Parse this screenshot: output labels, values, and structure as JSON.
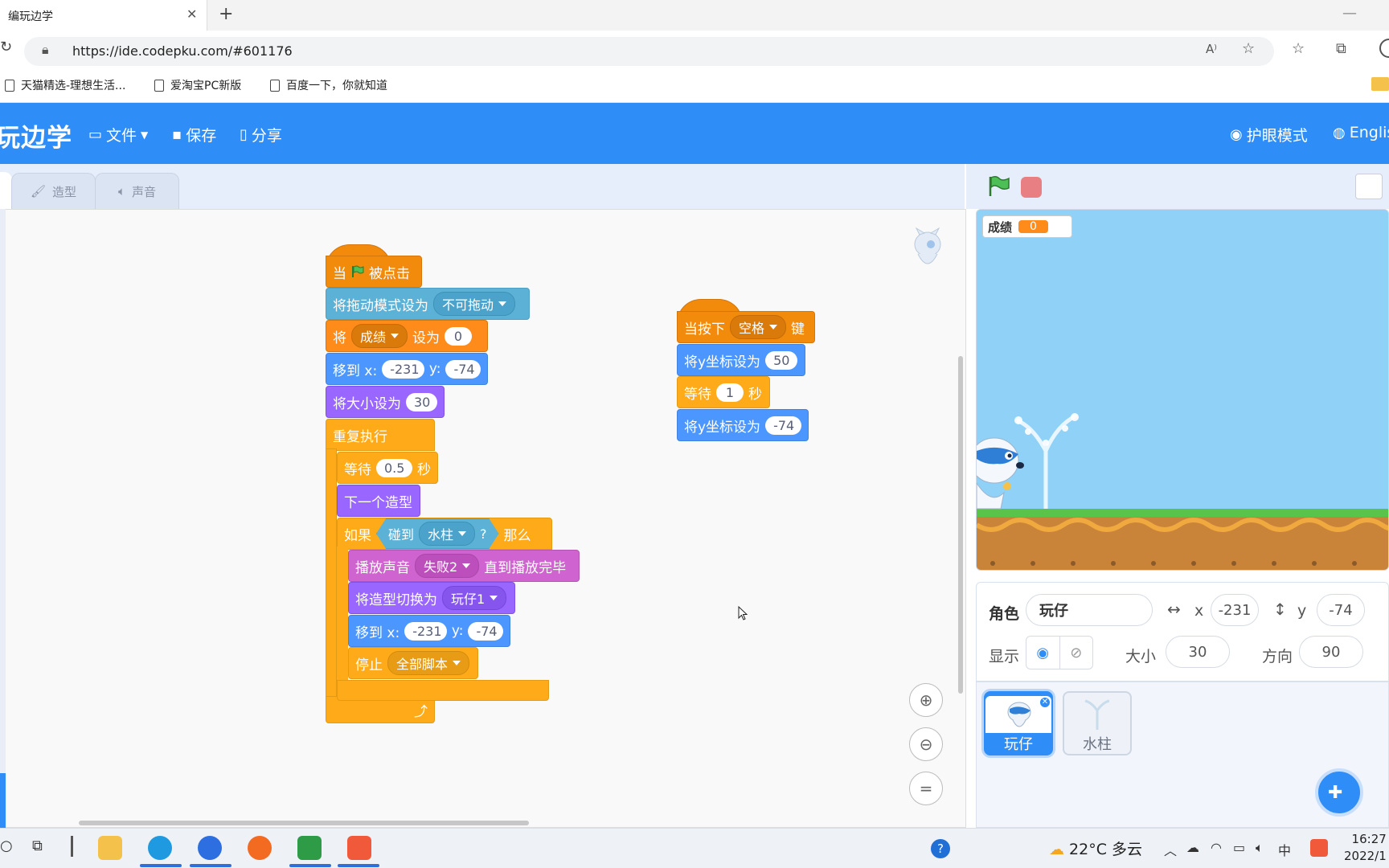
{
  "browser": {
    "tab_title": "编玩边学",
    "tab_close": "✕",
    "new_tab": "+",
    "url": "https://ide.codepku.com/#601176",
    "bookmarks": [
      "天猫精选-理想生活...",
      "爱淘宝PC新版",
      "百度一下，你就知道"
    ]
  },
  "app": {
    "logo": "玩边学",
    "menu": {
      "file": "文件",
      "save": "保存",
      "share": "分享"
    },
    "eye_mode": "护眼模式",
    "language": "Englis",
    "tabs": {
      "costume": "造型",
      "sound": "声音"
    }
  },
  "script1": {
    "hat_when": "当",
    "hat_clicked": "被点击",
    "drag_mode_label": "将拖动模式设为",
    "drag_mode_value": "不可拖动",
    "set_var_prefix": "将",
    "set_var_name": "成绩",
    "set_var_mid": "设为",
    "set_var_value": "0",
    "goto1_label": "移到 x:",
    "goto1_x": "-231",
    "goto1_y_label": "y:",
    "goto1_y": "-74",
    "size_label": "将大小设为",
    "size_value": "30",
    "forever_label": "重复执行",
    "wait_label": "等待",
    "wait_value": "0.5",
    "wait_unit": "秒",
    "next_costume": "下一个造型",
    "if_label": "如果",
    "touching_label": "碰到",
    "touching_target": "水柱",
    "touching_q": "?",
    "then_label": "那么",
    "play_sound_label": "播放声音",
    "play_sound_value": "失败2",
    "play_sound_suffix": "直到播放完毕",
    "switch_costume_label": "将造型切换为",
    "switch_costume_value": "玩仔1",
    "goto2_label": "移到 x:",
    "goto2_x": "-231",
    "goto2_y_label": "y:",
    "goto2_y": "-74",
    "stop_label": "停止",
    "stop_value": "全部脚本",
    "loop_arrow": "⤴"
  },
  "script2": {
    "hat_label": "当按下",
    "hat_key": "空格",
    "hat_suffix": "键",
    "sety1_label": "将y坐标设为",
    "sety1_value": "50",
    "wait_label": "等待",
    "wait_value": "1",
    "wait_unit": "秒",
    "sety2_label": "将y坐标设为",
    "sety2_value": "-74"
  },
  "stage": {
    "variable_name": "成绩",
    "variable_value": "0"
  },
  "sprite_info": {
    "sprite_label": "角色",
    "sprite_name": "玩仔",
    "x_label": "x",
    "x_value": "-231",
    "y_label": "y",
    "y_value": "-74",
    "show_label": "显示",
    "size_label": "大小",
    "size_value": "30",
    "direction_label": "方向",
    "direction_value": "90"
  },
  "sprites": [
    {
      "name": "玩仔",
      "selected": true
    },
    {
      "name": "水柱",
      "selected": false
    }
  ],
  "taskbar": {
    "temperature": "22°C",
    "weather": "多云",
    "ime": "中",
    "time": "16:27",
    "date": "2022/1"
  },
  "colors": {
    "brand_blue": "#2f8df7",
    "events": "#f28b0c",
    "motion": "#4c97ff",
    "looks": "#9966ff",
    "control": "#ffab19",
    "sound": "#cf63cf",
    "sensing": "#5cb1d6"
  }
}
